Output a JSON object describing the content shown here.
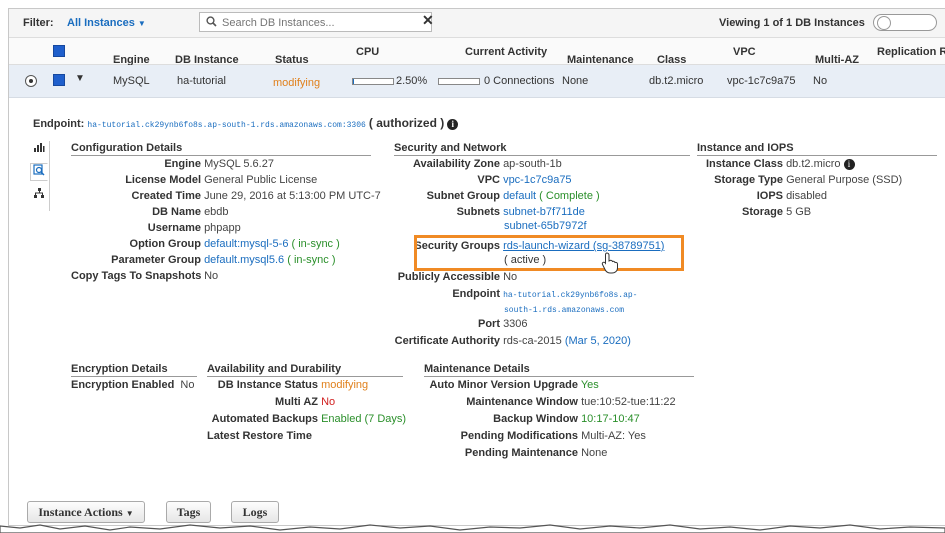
{
  "filter": {
    "label": "Filter:",
    "selected": "All Instances",
    "search_placeholder": "Search DB Instances...",
    "clear": "✕",
    "viewing": "Viewing 1 of 1 DB Instances"
  },
  "columns": {
    "engine": "Engine",
    "db_instance": "DB Instance",
    "status": "Status",
    "cpu": "CPU",
    "current_activity": "Current Activity",
    "maintenance": "Maintenance",
    "class": "Class",
    "vpc": "VPC",
    "multi_az": "Multi-AZ",
    "replication": "Replication R"
  },
  "row": {
    "engine": "MySQL",
    "db_instance": "ha-tutorial",
    "status": "modifying",
    "cpu_percent": 2.5,
    "cpu": "2.50%",
    "connections": "0 Connections",
    "maintenance": "None",
    "class": "db.t2.micro",
    "vpc": "vpc-1c7c9a75",
    "multi_az": "No"
  },
  "endpoint": {
    "label": "Endpoint:",
    "value": "ha-tutorial.ck29ynb6fo8s.ap-south-1.rds.amazonaws.com:3306",
    "authorized": "( authorized )"
  },
  "config": {
    "title": "Configuration Details",
    "engine_k": "Engine",
    "engine_v": "MySQL 5.6.27",
    "license_k": "License Model",
    "license_v": "General Public License",
    "created_k": "Created Time",
    "created_v": "June 29, 2016 at 5:13:00 PM UTC-7",
    "dbname_k": "DB Name",
    "dbname_v": "ebdb",
    "user_k": "Username",
    "user_v": "phpapp",
    "optgroup_k": "Option Group",
    "optgroup_v": "default:mysql-5-6",
    "optgroup_s": "( in-sync )",
    "paramgroup_k": "Parameter Group",
    "paramgroup_v": "default.mysql5.6",
    "paramgroup_s": "( in-sync )",
    "copytags_k": "Copy Tags To Snapshots",
    "copytags_v": "No"
  },
  "security": {
    "title": "Security and Network",
    "az_k": "Availability Zone",
    "az_v": "ap-south-1b",
    "vpc_k": "VPC",
    "vpc_v": "vpc-1c7c9a75",
    "subnet_k": "Subnet Group",
    "subnet_v": "default",
    "subnet_s": "( Complete )",
    "subnets_k": "Subnets",
    "subnets_v1": "subnet-b7f711de",
    "subnets_v2": "subnet-65b7972f",
    "sg_k": "Security Groups",
    "sg_v": "rds-launch-wizard (sg-38789751)",
    "sg_s": "( active )",
    "public_k": "Publicly Accessible",
    "public_v": "No",
    "endpoint_k": "Endpoint",
    "endpoint_v1": "ha-tutorial.ck29ynb6fo8s.ap-",
    "endpoint_v2": "south-1.rds.amazonaws.com",
    "port_k": "Port",
    "port_v": "3306",
    "cert_k": "Certificate Authority",
    "cert_v": "rds-ca-2015",
    "cert_date": "(Mar 5, 2020)"
  },
  "iops": {
    "title": "Instance and IOPS",
    "class_k": "Instance Class",
    "class_v": "db.t2.micro",
    "storage_type_k": "Storage Type",
    "storage_type_v": "General Purpose (SSD)",
    "iops_k": "IOPS",
    "iops_v": "disabled",
    "storage_k": "Storage",
    "storage_v": "5 GB"
  },
  "encryption": {
    "title": "Encryption Details",
    "enc_k": "Encryption Enabled",
    "enc_v": "No"
  },
  "availability": {
    "title": "Availability and Durability",
    "status_k": "DB Instance Status",
    "status_v": "modifying",
    "multiaz_k": "Multi AZ",
    "multiaz_v": "No",
    "backups_k": "Automated Backups",
    "backups_v": "Enabled (7 Days)",
    "restore_k": "Latest Restore Time"
  },
  "maintenance": {
    "title": "Maintenance Details",
    "auto_k": "Auto Minor Version Upgrade",
    "auto_v": "Yes",
    "window_k": "Maintenance Window",
    "window_v": "tue:10:52-tue:11:22",
    "backup_k": "Backup Window",
    "backup_v": "10:17-10:47",
    "pendmod_k": "Pending Modifications",
    "pendmod_v": "Multi-AZ: Yes",
    "pendmaint_k": "Pending Maintenance",
    "pendmaint_v": "None"
  },
  "buttons": {
    "instance_actions": "Instance Actions",
    "tags": "Tags",
    "logs": "Logs"
  }
}
